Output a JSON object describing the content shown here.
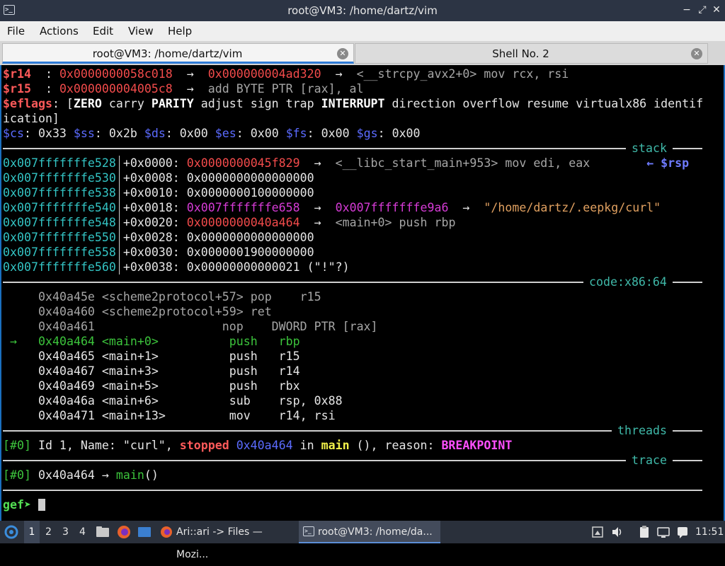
{
  "window": {
    "title": "root@VM3: /home/dartz/vim",
    "icon": "terminal-icon"
  },
  "menu": [
    "File",
    "Actions",
    "Edit",
    "View",
    "Help"
  ],
  "tabs": [
    {
      "label": "root@VM3: /home/dartz/vim",
      "active": true
    },
    {
      "label": "Shell No. 2",
      "active": false
    }
  ],
  "colors": {
    "titlebar": "#2c3444",
    "terminal_bg": "#000000",
    "accent": "#2f7bd6",
    "label_teal": "#3fb8a8"
  },
  "terminal": {
    "registers": {
      "r14_name": "$r14",
      "r14_sep": "  : ",
      "r14_val": "0x0000000058c018",
      "r14_arrow": "  →  ",
      "r14_ptr": "0x000000004ad320",
      "r14_arrow2": "  →  ",
      "r14_deref": "<__strcpy_avx2+0> mov rcx, rsi",
      "r15_name": "$r15",
      "r15_sep": "  : ",
      "r15_val": "0x000000004005c8",
      "r15_arrow": "  →  ",
      "r15_deref": "add BYTE PTR [rax], al",
      "eflags_name": "$eflags",
      "eflags_open": ": [",
      "eflags_zero": "ZERO",
      "eflags_carry": " carry ",
      "eflags_parity": "PARITY",
      "eflags_mid": " adjust sign trap ",
      "eflags_interrupt": "INTERRUPT",
      "eflags_rest": " direction overflow resume virtualx86 identif",
      "eflags_wrap": "ication]",
      "seg": [
        {
          "name": "$cs",
          "val": ": 0x33 "
        },
        {
          "name": "$ss",
          "val": ": 0x2b "
        },
        {
          "name": "$ds",
          "val": ": 0x00 "
        },
        {
          "name": "$es",
          "val": ": 0x00 "
        },
        {
          "name": "$fs",
          "val": ": 0x00 "
        },
        {
          "name": "$gs",
          "val": ": 0x00"
        }
      ]
    },
    "sections": {
      "stack": "stack",
      "code": "code:x86:64",
      "threads": "threads",
      "trace": "trace"
    },
    "stack": [
      {
        "addr": "0x007fffffffe528",
        "off": "+0x0000: ",
        "val": "0x0000000045f829",
        "val_color": "red",
        "arrow": "  →  ",
        "deref": "<__libc_start_main+953> mov edi, eax",
        "deref_color": "gray",
        "tag": "← $rsp"
      },
      {
        "addr": "0x007fffffffe530",
        "off": "+0x0008: ",
        "val": "0x0000000000000000",
        "val_color": "white"
      },
      {
        "addr": "0x007fffffffe538",
        "off": "+0x0010: ",
        "val": "0x0000000100000000",
        "val_color": "white"
      },
      {
        "addr": "0x007fffffffe540",
        "off": "+0x0018: ",
        "val": "0x007fffffffe658",
        "val_color": "mag",
        "arrow": "  →  ",
        "val2": "0x007fffffffe9a6",
        "arrow2": "  →  ",
        "deref": "\"/home/dartz/.eepkg/curl\"",
        "deref_color": "orange"
      },
      {
        "addr": "0x007fffffffe548",
        "off": "+0x0020: ",
        "val": "0x0000000040a464",
        "val_color": "red",
        "arrow": "  →  ",
        "deref": "<main+0> push rbp",
        "deref_color": "gray"
      },
      {
        "addr": "0x007fffffffe550",
        "off": "+0x0028: ",
        "val": "0x0000000000000000",
        "val_color": "white"
      },
      {
        "addr": "0x007fffffffe558",
        "off": "+0x0030: ",
        "val": "0x0000001900000000",
        "val_color": "white"
      },
      {
        "addr": "0x007fffffffe560",
        "off": "+0x0038: ",
        "val": "0x00000000000021 (\"!\"?)",
        "val_color": "white"
      }
    ],
    "code": [
      {
        "marker": "",
        "text": "0x40a45e <scheme2protocol+57> pop    r15",
        "style": "gray"
      },
      {
        "marker": "",
        "text": "0x40a460 <scheme2protocol+59> ret",
        "style": "gray"
      },
      {
        "marker": "",
        "text": "0x40a461                  nop    DWORD PTR [rax]",
        "style": "gray"
      },
      {
        "marker": "→",
        "text": "0x40a464 <main+0>          push   rbp",
        "style": "green"
      },
      {
        "marker": "",
        "text": "0x40a465 <main+1>          push   r15",
        "style": "white"
      },
      {
        "marker": "",
        "text": "0x40a467 <main+3>          push   r14",
        "style": "white"
      },
      {
        "marker": "",
        "text": "0x40a469 <main+5>          push   rbx",
        "style": "white"
      },
      {
        "marker": "",
        "text": "0x40a46a <main+6>          sub    rsp, 0x88",
        "style": "white"
      },
      {
        "marker": "",
        "text": "0x40a471 <main+13>         mov    r14, rsi",
        "style": "white"
      }
    ],
    "thread": {
      "id": "[#0]",
      "text1": " Id 1, Name: \"curl\", ",
      "stopped": "stopped",
      "addr": " 0x40a464",
      "in": " in ",
      "func": "main",
      "text2": " (), reason: ",
      "reason": "BREAKPOINT"
    },
    "trace": {
      "id": "[#0]",
      "text": " 0x40a464 → ",
      "func": "main",
      "tail": "()"
    },
    "prompt": "gef➤ "
  },
  "taskbar": {
    "menu_icon": "start-menu-icon",
    "workspaces": [
      "1",
      "2",
      "3",
      "4"
    ],
    "active_workspace": "1",
    "launchers": [
      "file-manager-icon",
      "firefox-icon",
      "desktop-icon"
    ],
    "tasks": [
      {
        "label": "Ari::ari -> Files — Mozi...",
        "icon": "firefox-icon",
        "active": false
      },
      {
        "label": "root@VM3: /home/da...",
        "icon": "terminal-icon",
        "active": true
      }
    ],
    "tray_icons": [
      "screenshot-icon",
      "volume-icon",
      "clipboard-icon",
      "network-icon",
      "notification-icon"
    ],
    "clock": "11:51"
  }
}
